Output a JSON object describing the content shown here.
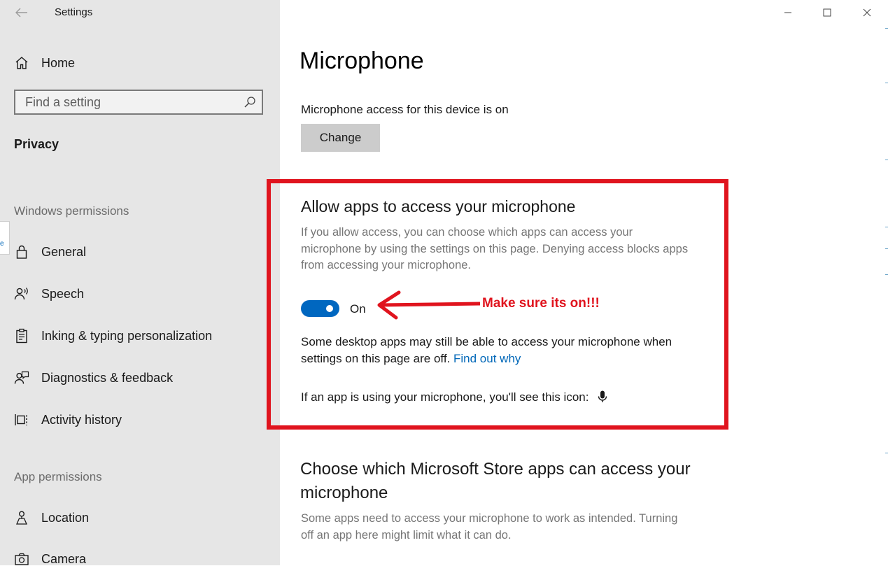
{
  "window": {
    "app_title": "Settings"
  },
  "sidebar": {
    "home_label": "Home",
    "search_placeholder": "Find a setting",
    "section_title": "Privacy",
    "windows_permissions_heading": "Windows permissions",
    "windows_permissions": [
      {
        "label": "General",
        "icon": "lock-icon"
      },
      {
        "label": "Speech",
        "icon": "speech-icon"
      },
      {
        "label": "Inking & typing personalization",
        "icon": "clipboard-icon"
      },
      {
        "label": "Diagnostics & feedback",
        "icon": "feedback-icon"
      },
      {
        "label": "Activity history",
        "icon": "activity-icon"
      }
    ],
    "app_permissions_heading": "App permissions",
    "app_permissions": [
      {
        "label": "Location",
        "icon": "location-icon"
      },
      {
        "label": "Camera",
        "icon": "camera-icon"
      }
    ],
    "edge_tab_glyph": "e"
  },
  "main": {
    "title": "Microphone",
    "device_access_text": "Microphone access for this device is on",
    "change_button": "Change",
    "allow_section": {
      "heading": "Allow apps to access your microphone",
      "description": "If you allow access, you can choose which apps can access your microphone by using the settings on this page. Denying access blocks apps from accessing your microphone.",
      "toggle_state": "On",
      "toggle_on": true,
      "desktop_note": "Some desktop apps may still be able to access your microphone when settings on this page are off.",
      "find_out_link": "Find out why",
      "icon_note": "If an app is using your microphone, you'll see this icon:"
    },
    "annotation": "Make sure its on!!!",
    "store_section": {
      "heading": "Choose which Microsoft Store apps can access your microphone",
      "description": "Some apps need to access your microphone to work as intended. Turning off an app here might limit what it can do."
    }
  },
  "colors": {
    "accent": "#0067c0",
    "link": "#0067b8",
    "annotation_red": "#e0141e",
    "sidebar_bg": "#e6e6e6"
  }
}
